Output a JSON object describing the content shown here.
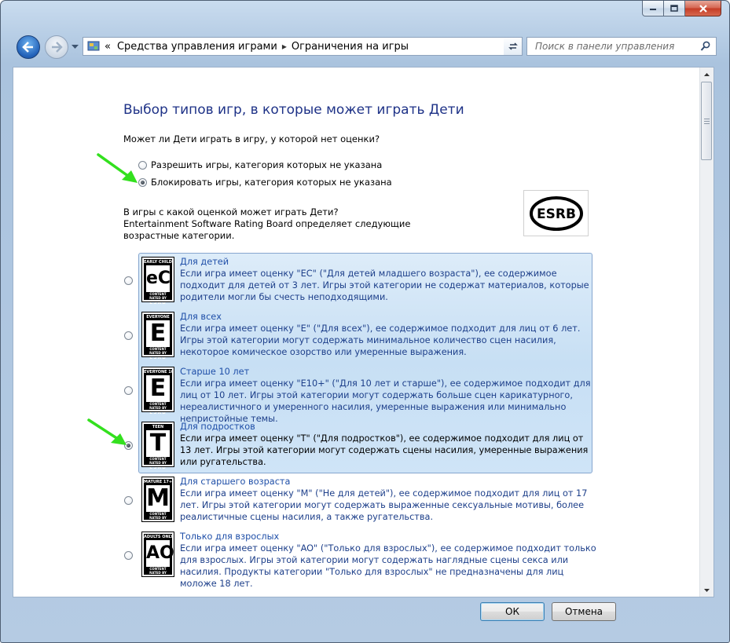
{
  "window": {
    "caption_buttons": [
      "minimize-icon",
      "maximize-icon",
      "close-icon"
    ]
  },
  "navbar": {
    "breadcrumb": [
      "Средства управления играми",
      "Ограничения на игры"
    ],
    "breadcrumb_prefix": "«",
    "breadcrumb_separator": "▸",
    "search_placeholder": "Поиск в панели управления"
  },
  "page": {
    "heading": "Выбор типов игр, в которые может играть Дети",
    "unrated_question": "Может ли Дети играть в игру, у которой нет оценки?",
    "unrated_options": [
      {
        "label": "Разрешить игры, категория которых не указана",
        "checked": false
      },
      {
        "label": "Блокировать игры, категория которых не указана",
        "checked": true
      }
    ],
    "rating_question": "В игры с какой оценкой может играть Дети?\nEntertainment Software Rating Board определяет следующие возрастные категории.",
    "esrb_logo_text": "ESRB",
    "ratings": [
      {
        "badge_top": "EARLY CHILDHOOD",
        "badge_letter": "eC",
        "badge_bottom": "CONTENT RATED BY",
        "badge_org": "ESRB",
        "title": "Для детей",
        "description": "Если игра имеет оценку \"EC\" (\"Для детей младшего возраста\"), ее содержимое подходит для детей от 3 лет.  Игры этой категории не содержат материалов, которые родители могли бы счесть неподходящими.",
        "checked": false
      },
      {
        "badge_top": "EVERYONE",
        "badge_letter": "E",
        "badge_bottom": "CONTENT RATED BY",
        "badge_org": "ESRB",
        "title": "Для всех",
        "description": "Если игра имеет оценку \"E\" (\"Для всех\"), ее содержимое подходит для лиц от 6 лет.  Игры этой категории могут содержать минимальное количество сцен насилия, некоторое комическое озорство или умеренные выражения.",
        "checked": false
      },
      {
        "badge_top": "EVERYONE 10+",
        "badge_letter": "E",
        "badge_bottom": "CONTENT RATED BY",
        "badge_org": "ESRB",
        "title": "Старше 10 лет",
        "description": "Если игра имеет оценку \"E10+\" (\"Для 10 лет и старше\"), ее содержимое подходит для лиц от 10 лет. Игры этой категории могут содержать больше сцен карикатурного, нереалистичного и умеренного насилия, умеренные выражения или минимально непристойные темы.",
        "checked": false
      },
      {
        "badge_top": "TEEN",
        "badge_letter": "T",
        "badge_bottom": "CONTENT RATED BY",
        "badge_org": "ESRB",
        "title": "Для подростков",
        "description": "Если игра имеет оценку \"T\" (\"Для подростков\"), ее содержимое подходит для лиц от 13 лет. Игры этой категории могут содержать сцены насилия, умеренные выражения или ругательства.",
        "checked": true
      },
      {
        "badge_top": "MATURE 17+",
        "badge_letter": "M",
        "badge_bottom": "CONTENT RATED BY",
        "badge_org": "ESRB",
        "title": "Для старшего возраста",
        "description": "Если игра имеет оценку \"M\" (\"Не для детей\"), ее содержимое подходит для лиц от 17 лет. Игры этой категории могут содержать выраженные сексуальные мотивы, более реалистичные сцены насилия, а также ругательства.",
        "checked": false
      },
      {
        "badge_top": "ADULTS ONLY 18+",
        "badge_letter": "AO",
        "badge_bottom": "CONTENT RATED BY",
        "badge_org": "ESRB",
        "title": "Только для взрослых",
        "description": "Если игра имеет оценку \"AO\" (\"Только для взрослых\"), ее содержимое подходит только для взрослых.  Игры этой категории могут содержать наглядные сцены секса или насилия. Продукты категории \"Только для взрослых\" не предназначены для лиц моложе 18 лет.",
        "checked": false
      }
    ]
  },
  "footer": {
    "ok_label": "ОК",
    "cancel_label": "Отмена"
  },
  "colors": {
    "heading": "#1e3287",
    "link_blue": "#1f4fa8",
    "selection_band": "#c7dff4",
    "annotation_arrow": "#33e01e"
  }
}
